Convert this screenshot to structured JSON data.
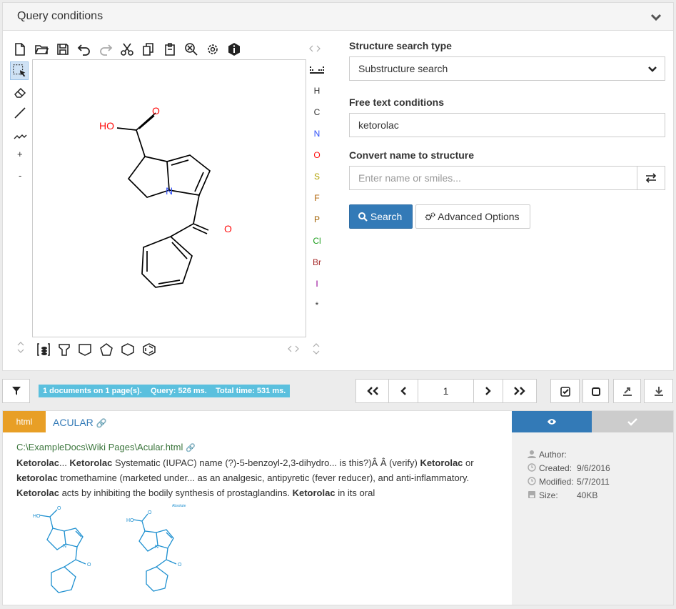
{
  "query": {
    "title": "Query conditions",
    "atoms": [
      "H",
      "C",
      "N",
      "O",
      "S",
      "F",
      "P",
      "Cl",
      "Br",
      "I",
      "*"
    ],
    "atom_colors": {
      "H": "#333",
      "C": "#333",
      "N": "#3050f8",
      "O": "#ff0d0d",
      "S": "#b0a000",
      "F": "#b06000",
      "P": "#a06000",
      "Cl": "#1f9f1f",
      "Br": "#a62929",
      "I": "#940094",
      "*": "#333"
    },
    "side_tools": {
      "plus": "+",
      "minus": "-"
    },
    "molecule": {
      "oh_label": "HO",
      "o_label": "O",
      "n_label": "N",
      "o2_label": "O"
    }
  },
  "form": {
    "search_type_label": "Structure search type",
    "search_type_value": "Substructure search",
    "free_text_label": "Free text conditions",
    "free_text_value": "ketorolac",
    "convert_label": "Convert name to structure",
    "convert_placeholder": "Enter name or smiles...",
    "search_button": "Search",
    "advanced_button": "Advanced Options"
  },
  "status": {
    "text": "1 documents on 1 page(s).    Query: 526 ms.    Total time: 531 ms.",
    "page": "1"
  },
  "result": {
    "tag": "html",
    "title": "ACULAR",
    "path": "C:\\ExampleDocs\\Wiki Pages\\Acular.html",
    "snippet": [
      {
        "b": true,
        "t": "Ketorolac"
      },
      {
        "b": false,
        "t": "... "
      },
      {
        "b": true,
        "t": "Ketorolac"
      },
      {
        "b": false,
        "t": " Systematic (IUPAC) name (?)-5-benzoyl-2,3-dihydro... is this?)Â Â (verify) "
      },
      {
        "b": true,
        "t": "Ketorolac"
      },
      {
        "b": false,
        "t": " or "
      },
      {
        "b": true,
        "t": "ketorolac"
      },
      {
        "b": false,
        "t": " tromethamine (marketed under... as an analgesic, antipyretic (fever reducer), and anti-inflammatory. "
      },
      {
        "b": true,
        "t": "Ketorolac"
      },
      {
        "b": false,
        "t": " acts by inhibiting the bodily synthesis of prostaglandins. "
      },
      {
        "b": true,
        "t": "Ketorolac"
      },
      {
        "b": false,
        "t": " in its oral"
      }
    ],
    "thumb2_label": "Absolute",
    "meta": {
      "author_label": "Author:",
      "author": "",
      "created_label": "Created:",
      "created": "9/6/2016",
      "modified_label": "Modified:",
      "modified": "5/7/2011",
      "size_label": "Size:",
      "size": "40KB"
    }
  },
  "colors": {
    "primary": "#337ab7",
    "tag": "#e89f26",
    "status": "#5bc0de",
    "path": "#3c763d"
  }
}
